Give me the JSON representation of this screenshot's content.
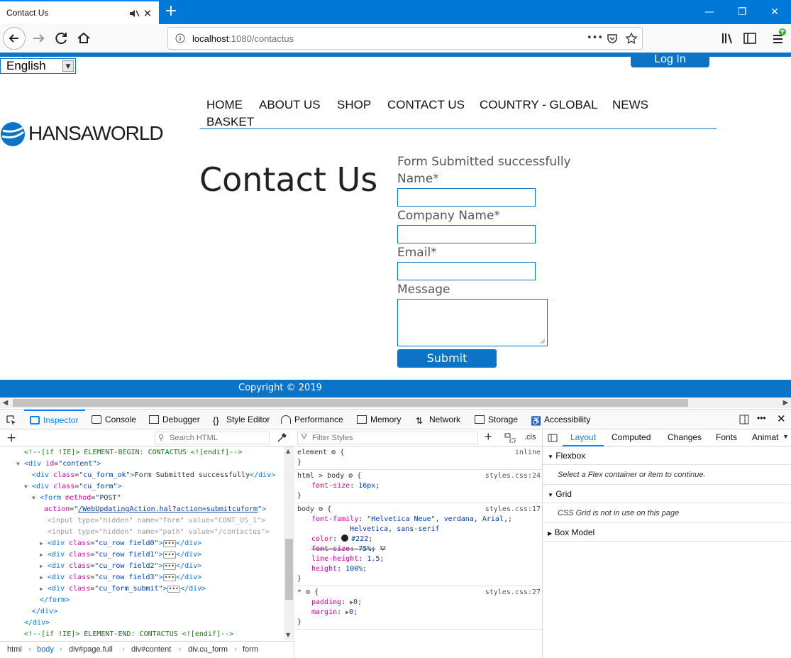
{
  "browser": {
    "tab_title": "Contact Us",
    "url_host": "localhost",
    "url_path": ":1080/contactus",
    "page_actions_label": "•••"
  },
  "page": {
    "language": "English",
    "login_label": "Log In",
    "logo_text": "HANSAWORLD",
    "nav": [
      "HOME",
      "ABOUT US",
      "SHOP",
      "CONTACT US",
      "COUNTRY - GLOBAL",
      "NEWS",
      "BASKET"
    ],
    "heading": "Contact Us",
    "form_ok": "Form Submitted successfully",
    "fields": [
      {
        "label": "Name*"
      },
      {
        "label": "Company Name*"
      },
      {
        "label": "Email*"
      },
      {
        "label": "Message"
      }
    ],
    "submit_label": "Submit",
    "footer": "Copyright © 2019"
  },
  "devtools": {
    "tabs": [
      "Inspector",
      "Console",
      "Debugger",
      "Style Editor",
      "Performance",
      "Memory",
      "Network",
      "Storage",
      "Accessibility"
    ],
    "search_placeholder": "Search HTML",
    "filter_placeholder": "Filter Styles",
    "cls_label": ".cls",
    "markup": [
      {
        "indent": 0,
        "exp": "",
        "html": "<span class='c-cmt'>&lt;!--[if !IE]&gt; ELEMENT-BEGIN: CONTACTUS &lt;![endif]--&gt;</span>"
      },
      {
        "indent": 0,
        "exp": "▼",
        "html": "<span class='c-tag'>&lt;div</span> <span class='c-attr'>id</span>=<span class='c-val'>\"content\"</span><span class='c-tag'>&gt;</span>"
      },
      {
        "indent": 1,
        "exp": "",
        "html": "<span class='c-tag'>&lt;div</span> <span class='c-attr'>class</span>=<span class='c-val'>\"cu_form_ok\"</span><span class='c-tag'>&gt;</span>Form Submitted successfully<span class='c-tag'>&lt;/div&gt;</span>"
      },
      {
        "indent": 1,
        "exp": "▼",
        "html": "<span class='c-tag'>&lt;div</span> <span class='c-attr'>class</span>=<span class='c-val'>\"cu_form\"</span><span class='c-tag'>&gt;</span>"
      },
      {
        "indent": 2,
        "exp": "▼",
        "html": "<span class='c-tag'>&lt;form</span> <span class='c-attr'>method</span>=<span class='c-val'>\"POST\"</span>"
      },
      {
        "indent": 2,
        "exp": "",
        "html": "&nbsp;<span class='c-attr'>action</span>=<span class='c-val'>\"<u>/WebUpdatingAction.hal?action=submitcuform</u>\"</span><span class='c-tag'>&gt;</span>"
      },
      {
        "indent": 3,
        "exp": "",
        "html": "<span class='c-hid'>&lt;input type=\"hidden\" name=\"form\" value=\"CONT_US_1\"&gt;</span>"
      },
      {
        "indent": 3,
        "exp": "",
        "html": "<span class='c-hid'>&lt;input type=\"hidden\" name=\"path\" value=\"/contactus\"&gt;</span>"
      },
      {
        "indent": 3,
        "exp": "▶",
        "html": "<span class='c-tag'>&lt;div</span> <span class='c-attr'>class</span>=<span class='c-val'>\"cu_row field0\"</span><span class='c-tag'>&gt;</span><span class='ell'>•••</span><span class='c-tag'>&lt;/div&gt;</span>"
      },
      {
        "indent": 3,
        "exp": "▶",
        "html": "<span class='c-tag'>&lt;div</span> <span class='c-attr'>class</span>=<span class='c-val'>\"cu_row field1\"</span><span class='c-tag'>&gt;</span><span class='ell'>•••</span><span class='c-tag'>&lt;/div&gt;</span>"
      },
      {
        "indent": 3,
        "exp": "▶",
        "html": "<span class='c-tag'>&lt;div</span> <span class='c-attr'>class</span>=<span class='c-val'>\"cu_row field2\"</span><span class='c-tag'>&gt;</span><span class='ell'>•••</span><span class='c-tag'>&lt;/div&gt;</span>"
      },
      {
        "indent": 3,
        "exp": "▶",
        "html": "<span class='c-tag'>&lt;div</span> <span class='c-attr'>class</span>=<span class='c-val'>\"cu_row field3\"</span><span class='c-tag'>&gt;</span><span class='ell'>•••</span><span class='c-tag'>&lt;/div&gt;</span>"
      },
      {
        "indent": 3,
        "exp": "▶",
        "html": "<span class='c-tag'>&lt;div</span> <span class='c-attr'>class</span>=<span class='c-val'>\"cu_form_submit\"</span><span class='c-tag'>&gt;</span><span class='ell'>•••</span><span class='c-tag'>&lt;/div&gt;</span>"
      },
      {
        "indent": 2,
        "exp": "",
        "html": "<span class='c-tag'>&lt;/form&gt;</span>"
      },
      {
        "indent": 1,
        "exp": "",
        "html": "<span class='c-tag'>&lt;/div&gt;</span>"
      },
      {
        "indent": 0,
        "exp": "",
        "html": "<span class='c-tag'>&lt;/div&gt;</span>"
      },
      {
        "indent": 0,
        "exp": "",
        "html": "<span class='c-cmt'>&lt;!--[if !IE]&gt; ELEMENT-END: CONTACTUS &lt;![endif]--&gt;</span>"
      }
    ],
    "breadcrumb": [
      "html",
      "body",
      "div#page.full",
      "div#content",
      "div.cu_form",
      "form"
    ],
    "rules": [
      {
        "selector": "element",
        "source": "inline",
        "props": []
      },
      {
        "selector": "html > body",
        "source": "styles.css:24",
        "props": [
          [
            "font-size",
            "16px"
          ]
        ]
      },
      {
        "selector": "body",
        "source": "styles.css:17",
        "props": [
          [
            "font-family",
            "\"Helvetica Neue\", verdana, Arial,"
          ],
          [
            "",
            "Helvetica, sans-serif"
          ],
          [
            "color",
            "#222"
          ],
          [
            "font-size",
            "75%",
            "strike"
          ],
          [
            "line-height",
            "1.5"
          ],
          [
            "height",
            "100%"
          ]
        ]
      },
      {
        "selector": "*",
        "source": "styles.css:27",
        "props": [
          [
            "padding",
            "0"
          ],
          [
            "margin",
            "0"
          ]
        ]
      }
    ],
    "side_tabs": [
      "Layout",
      "Computed",
      "Changes",
      "Fonts",
      "Animat"
    ],
    "sections": [
      {
        "title": "Flexbox",
        "note": "Select a Flex container or item to continue."
      },
      {
        "title": "Grid",
        "note": "CSS Grid is not in use on this page"
      },
      {
        "title": "Box Model",
        "note": ""
      }
    ]
  },
  "colors": {
    "accent": "#0b74c7",
    "chrome": "#0078d7",
    "devtools_accent": "#0a84ff"
  }
}
